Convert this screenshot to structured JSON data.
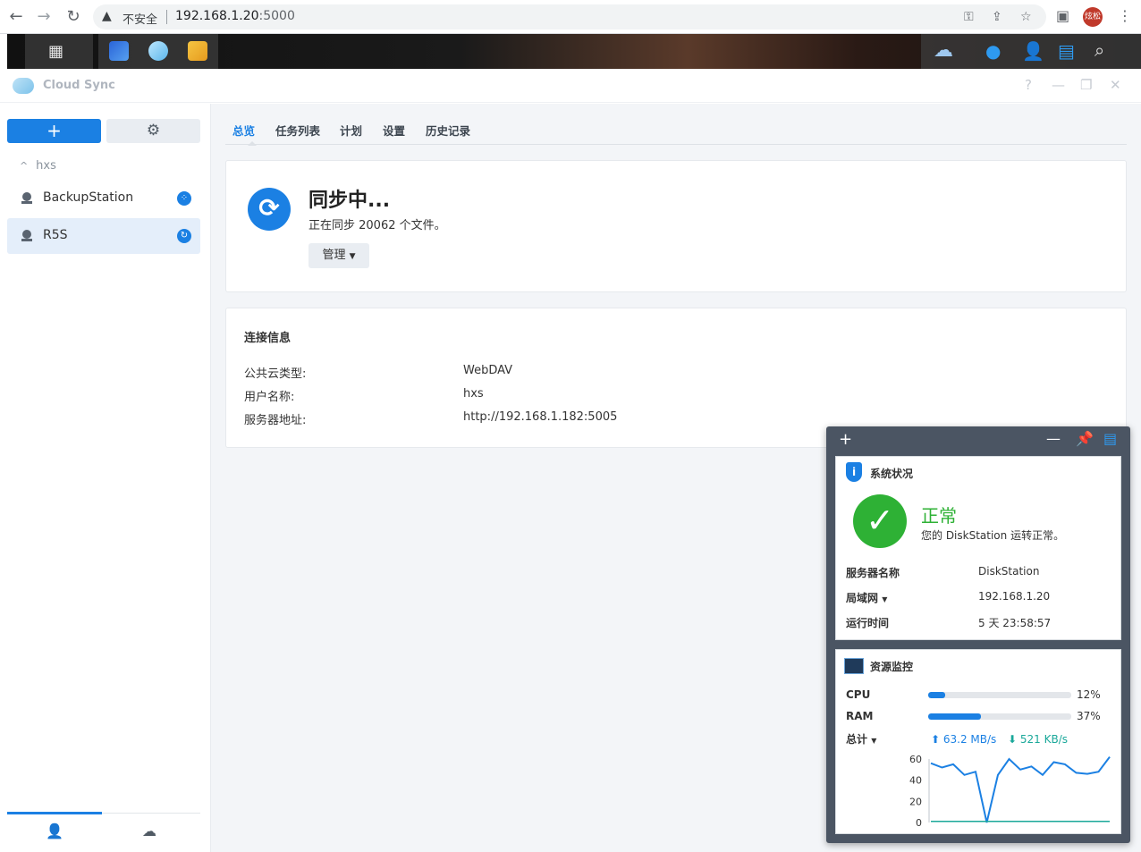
{
  "browser": {
    "insecure_label": "不安全",
    "url_host": "192.168.1.20",
    "url_port": ":5000",
    "profile_label": "炫松"
  },
  "window": {
    "title": "Cloud Sync",
    "help": "?"
  },
  "sidebar": {
    "add_label": "+",
    "group": "hxs",
    "connections": [
      {
        "label": "BackupStation",
        "status": "idle"
      },
      {
        "label": "R5S",
        "status": "syncing"
      }
    ]
  },
  "tabs": [
    {
      "label": "总览"
    },
    {
      "label": "任务列表"
    },
    {
      "label": "计划"
    },
    {
      "label": "设置"
    },
    {
      "label": "历史记录"
    }
  ],
  "sync_status": {
    "title": "同步中...",
    "subtitle": "正在同步 20062 个文件。",
    "manage_label": "管理"
  },
  "connection_info": {
    "title": "连接信息",
    "rows": [
      {
        "label": "公共云类型:",
        "value": "WebDAV"
      },
      {
        "label": "用户名称:",
        "value": "hxs"
      },
      {
        "label": "服务器地址:",
        "value": "http://192.168.1.182:5005"
      }
    ]
  },
  "widgets": {
    "system": {
      "title": "系统状况",
      "status": "正常",
      "message": "您的 DiskStation 运转正常。",
      "rows": [
        {
          "label": "服务器名称",
          "value": "DiskStation"
        },
        {
          "label": "局域网",
          "value": "192.168.1.20"
        },
        {
          "label": "运行时间",
          "value": "5 天 23:58:57"
        }
      ]
    },
    "resource": {
      "title": "资源监控",
      "cpu_label": "CPU",
      "cpu_pct": "12%",
      "cpu_value": 0.12,
      "ram_label": "RAM",
      "ram_pct": "37%",
      "ram_value": 0.37,
      "total_label": "总计",
      "upload": "63.2 MB/s",
      "download": "521 KB/s"
    }
  },
  "chart_data": {
    "type": "line",
    "y_ticks": [
      "60",
      "40",
      "20",
      "0"
    ],
    "ylim": [
      0,
      60
    ],
    "series": [
      {
        "values": [
          56,
          52,
          55,
          45,
          48,
          0,
          45,
          60,
          50,
          53,
          45,
          57,
          55,
          47,
          46,
          48,
          62
        ],
        "color": "#1b80e3"
      },
      {
        "values": [
          1,
          1,
          1,
          1,
          1,
          1,
          1,
          1,
          1,
          1,
          1,
          1,
          1,
          1,
          1,
          1,
          1
        ],
        "color": "#1aa89a"
      }
    ]
  }
}
